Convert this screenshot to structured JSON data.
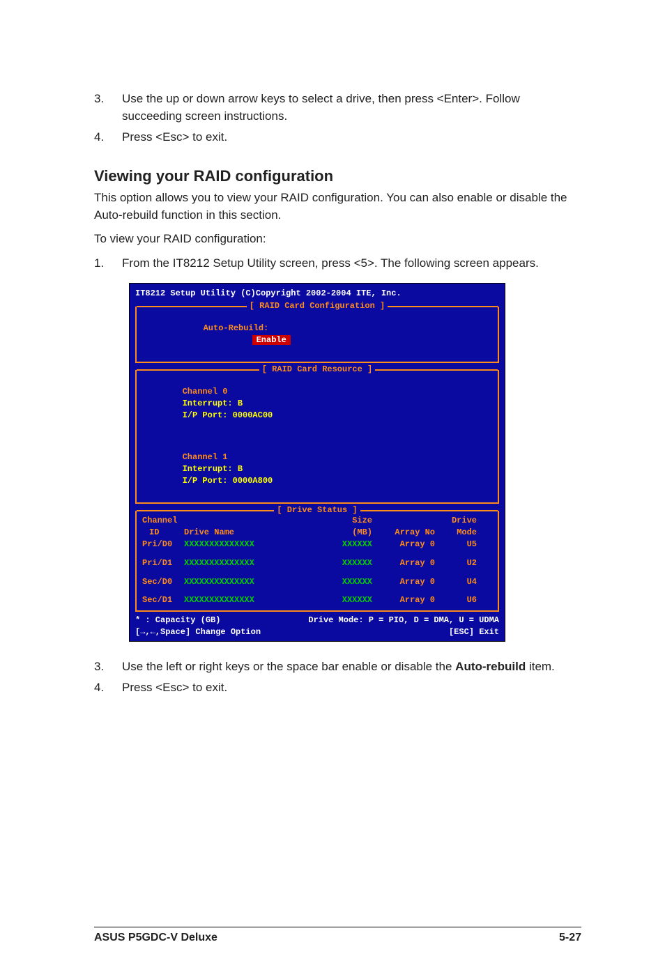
{
  "steps_top": [
    {
      "n": "3.",
      "t": "Use the up or down arrow keys to select a drive, then press <Enter>. Follow succeeding screen instructions."
    },
    {
      "n": "4.",
      "t": "Press <Esc> to exit."
    }
  ],
  "heading": "Viewing your RAID configuration",
  "intro": "This option allows you to view your RAID configuration. You can also enable or disable the Auto-rebuild function in this section.",
  "to_view": "To view your RAID configuration:",
  "step1": {
    "n": "1.",
    "t": "From the IT8212 Setup Utility screen, press <5>. The following screen appears."
  },
  "term": {
    "title": "IT8212 Setup Utility (C)Copyright 2002-2004 ITE, Inc.",
    "box1_legend": "[ RAID Card Configuration ]",
    "auto_rebuild_label": "Auto-Rebuild:",
    "auto_rebuild_value": "Enable",
    "box2_legend": "[ RAID Card Resource ]",
    "ch0": {
      "name": "Channel 0",
      "intr_l": "Interrupt: B",
      "port_l": "I/P Port: 0000AC00"
    },
    "ch1": {
      "name": "Channel 1",
      "intr_l": "Interrupt: B",
      "port_l": "I/P Port: 0000A800"
    },
    "box3_legend": "[ Drive Status ]",
    "col": {
      "c1a": "Channel",
      "c1b": "ID",
      "c2": "Drive Name",
      "c3a": "Size",
      "c3b": "(MB)",
      "c4": "Array No",
      "c5a": "Drive",
      "c5b": "Mode"
    },
    "rows": [
      {
        "id": "Pri/D0",
        "name": "XXXXXXXXXXXXXX",
        "size": "XXXXXX",
        "array": "Array 0",
        "mode": "U5"
      },
      {
        "id": "Pri/D1",
        "name": "XXXXXXXXXXXXXX",
        "size": "XXXXXX",
        "array": "Array 0",
        "mode": "U2"
      },
      {
        "id": "Sec/D0",
        "name": "XXXXXXXXXXXXXX",
        "size": "XXXXXX",
        "array": "Array 0",
        "mode": "U4"
      },
      {
        "id": "Sec/D1",
        "name": "XXXXXXXXXXXXXX",
        "size": "XXXXXX",
        "array": "Array 0",
        "mode": "U6"
      }
    ],
    "footer1_left": "* : Capacity (GB)",
    "footer1_right": "Drive Mode: P = PIO, D = DMA, U = UDMA",
    "footer2_left": "[→,←,Space] Change Option",
    "footer2_right": "[ESC] Exit"
  },
  "step3": {
    "n": "3.",
    "t_pre": "Use the left or right keys or the space bar enable or disable the ",
    "bold": "Auto-rebuild",
    "t_post": " item."
  },
  "step4": {
    "n": "4.",
    "t": "Press <Esc> to exit."
  },
  "footer_left": "ASUS P5GDC-V Deluxe",
  "footer_right": "5-27"
}
